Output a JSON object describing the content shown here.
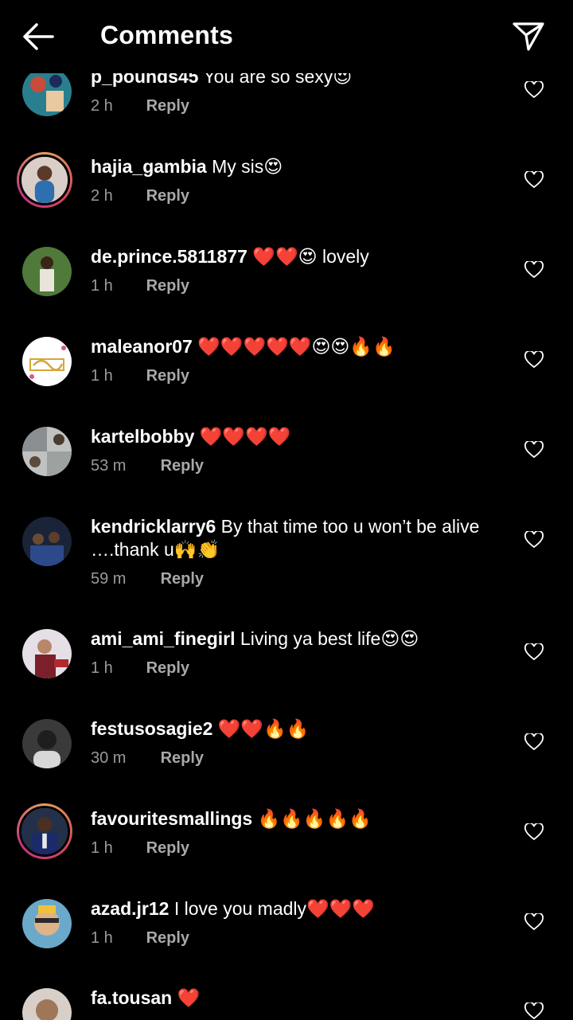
{
  "header": {
    "title": "Comments",
    "back_icon": "arrow-left-icon",
    "send_icon": "paper-plane-icon"
  },
  "reply_label": "Reply",
  "comments": [
    {
      "username": "p_pounds45",
      "text": "You are so sexy😍",
      "time": "2 h"
    },
    {
      "username": "hajia_gambia",
      "text": "My sis😍",
      "time": "2 h"
    },
    {
      "username": "de.prince.5811877",
      "text": "❤️❤️😍 lovely",
      "time": "1 h"
    },
    {
      "username": "maleanor07",
      "text": "❤️❤️❤️❤️❤️😍😍🔥🔥",
      "time": "1 h"
    },
    {
      "username": "kartelbobby",
      "text": "❤️❤️❤️❤️",
      "time": "53 m"
    },
    {
      "username": "kendricklarry6",
      "text": "By that time too u won’t be alive ….thank u🙌👏",
      "time": "59 m"
    },
    {
      "username": "ami_ami_finegirl",
      "text": "Living ya best life😍😍",
      "time": "1 h"
    },
    {
      "username": "festusosagie2",
      "text": "❤️❤️🔥🔥",
      "time": "30 m"
    },
    {
      "username": "favouritesmallings",
      "text": "🔥🔥🔥🔥🔥",
      "time": "1 h"
    },
    {
      "username": "azad.jr12",
      "text": "I love you madly❤️❤️❤️",
      "time": "1 h"
    },
    {
      "username": "fa.tousan",
      "text": "❤️",
      "time": ""
    }
  ]
}
